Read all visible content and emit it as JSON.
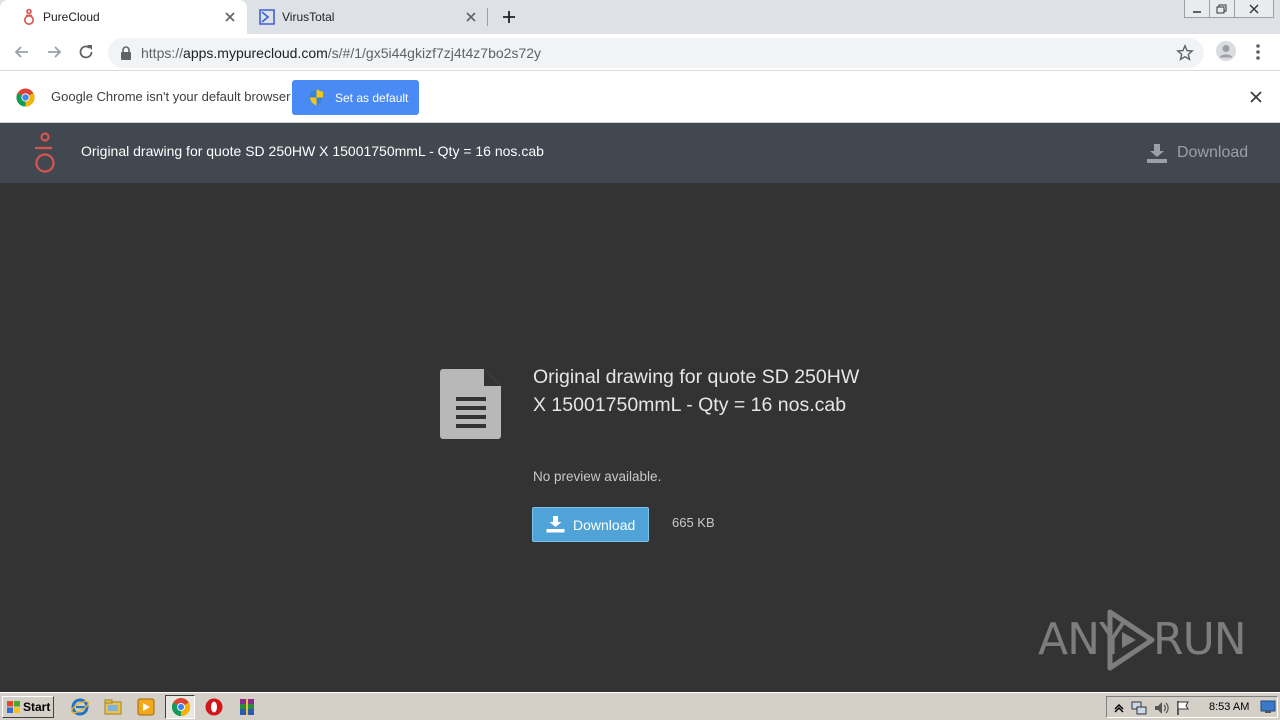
{
  "browser": {
    "tabs": [
      {
        "title": "PureCloud",
        "active": true
      },
      {
        "title": "VirusTotal",
        "active": false
      }
    ],
    "url": {
      "scheme": "https://",
      "host": "apps.mypurecloud.com",
      "path": "/s/#/1/gx5i44gkizf7zj4t4z7bo2s72y"
    },
    "infobar": {
      "message": "Google Chrome isn't your default browser",
      "button_label": "Set as default"
    }
  },
  "app": {
    "header_title": "Original drawing for quote SD 250HW X 15001750mmL - Qty = 16 nos.cab",
    "header_download_label": "Download",
    "file": {
      "name": "Original drawing for quote SD 250HW X 15001750mmL - Qty = 16 nos.cab",
      "preview_message": "No preview available.",
      "download_label": "Download",
      "size": "665 KB"
    },
    "colors": {
      "header_bg": "#424850",
      "content_bg": "#333333",
      "download_button": "#4fa3d6",
      "brand_accent": "#d9534f"
    }
  },
  "watermark": {
    "left": "ANY",
    "right": "RUN"
  },
  "taskbar": {
    "start_label": "Start",
    "clock": "8:53 AM"
  }
}
